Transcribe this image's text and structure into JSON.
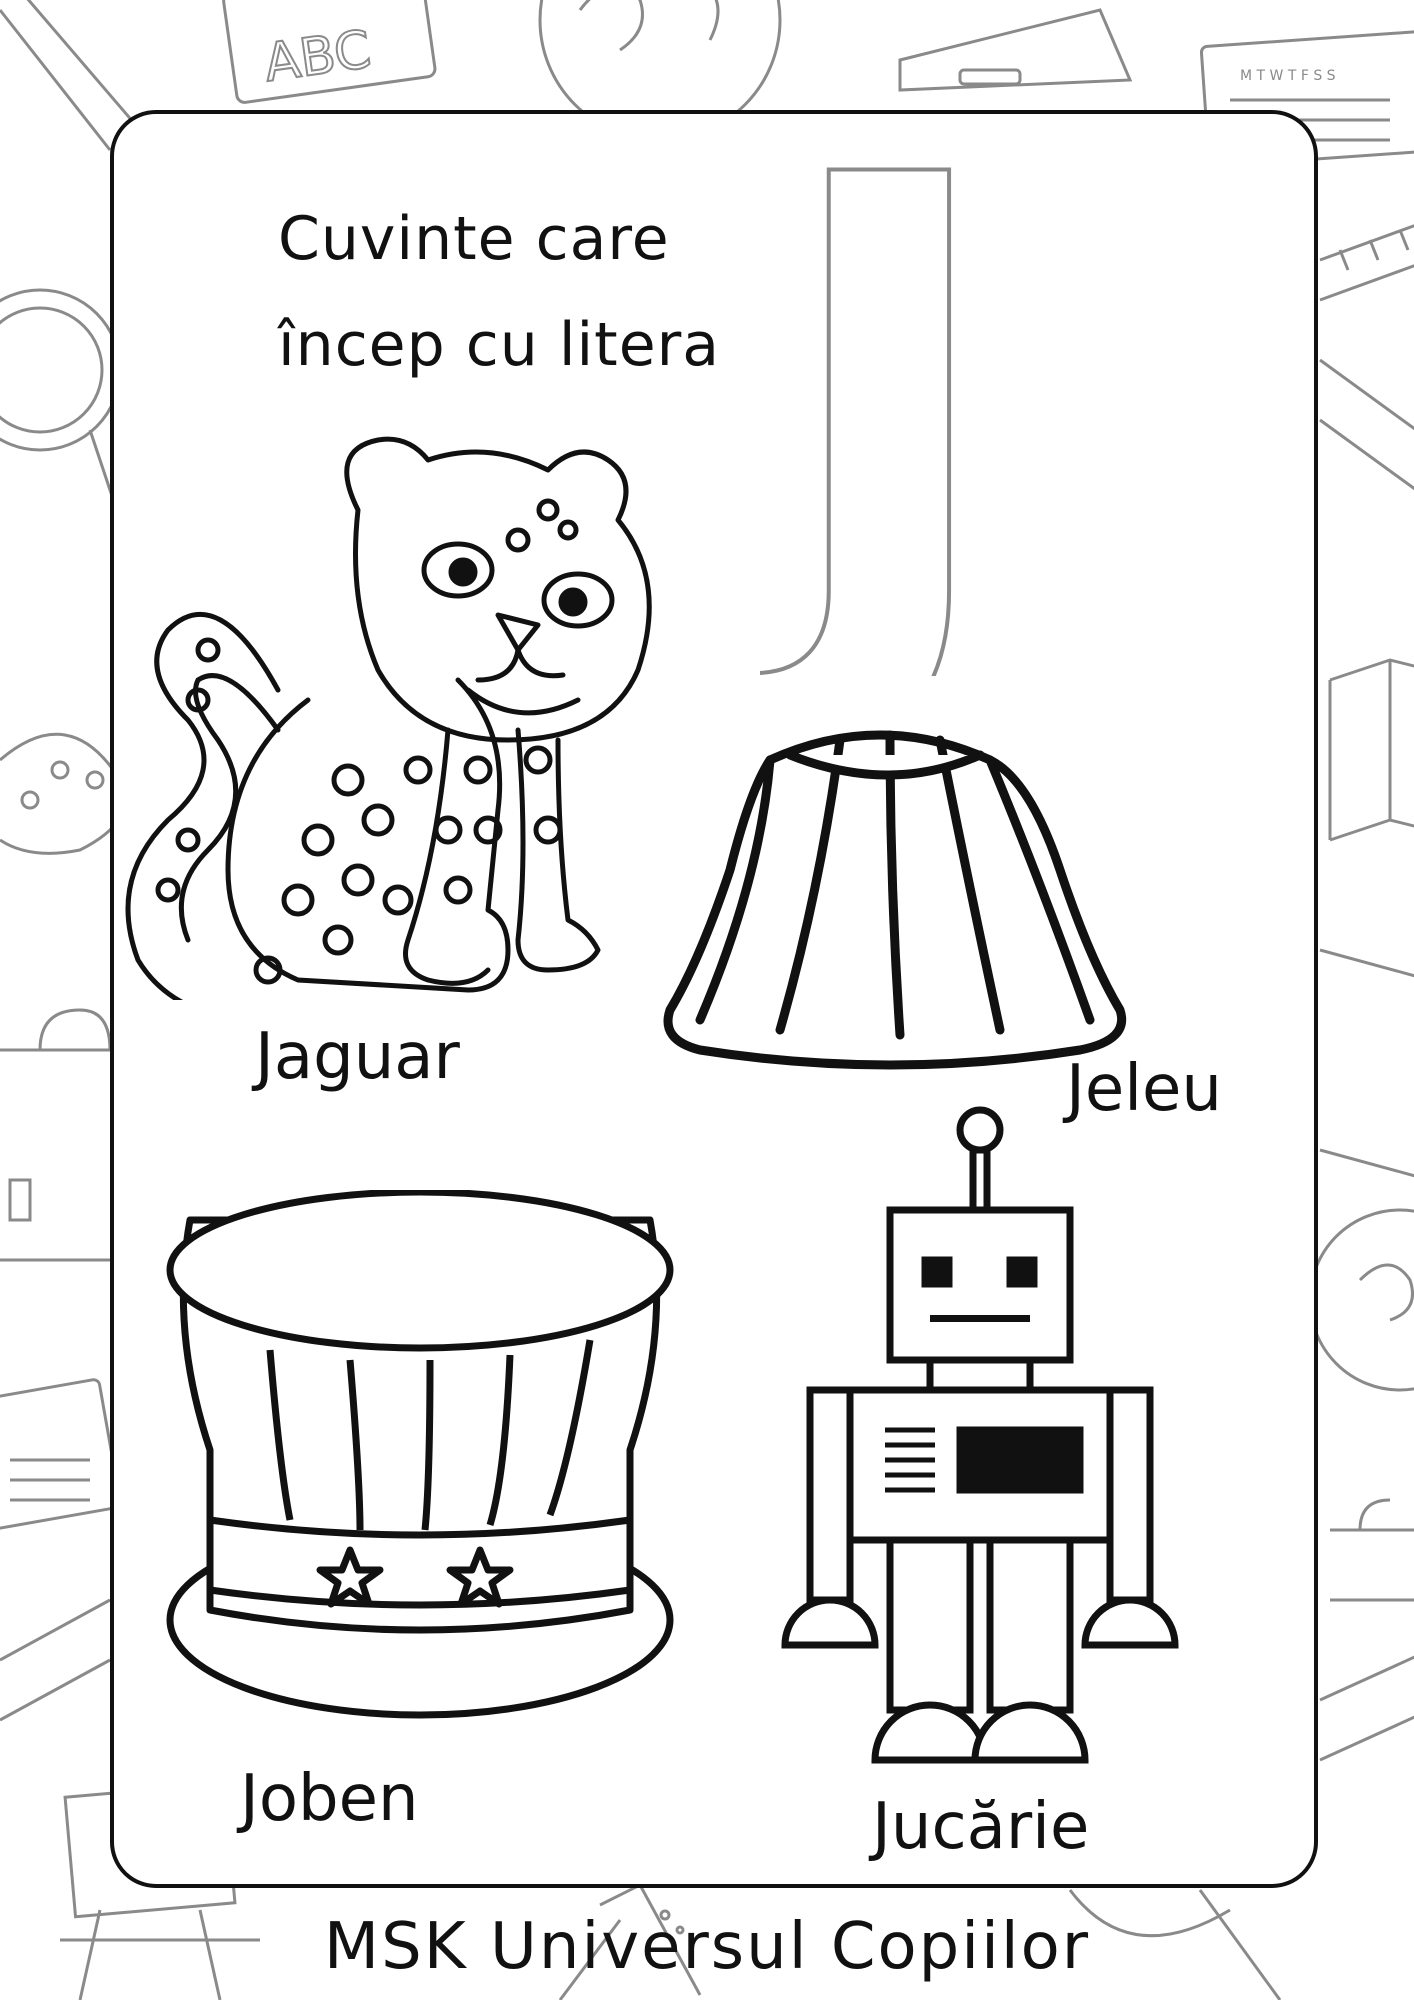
{
  "heading": {
    "line1": "Cuvinte care",
    "line2": "încep cu litera"
  },
  "letter": "J",
  "background_doodles": {
    "slate_text": "ABC",
    "calendar_days": "M T W T F S S"
  },
  "items": [
    {
      "word": "Jaguar",
      "icon": "jaguar-icon"
    },
    {
      "word": "Jeleu",
      "icon": "jelly-icon"
    },
    {
      "word": "Joben",
      "icon": "top-hat-icon"
    },
    {
      "word": "Jucărie",
      "icon": "robot-icon"
    }
  ],
  "footer": "MSK Universul Copiilor",
  "colors": {
    "ink": "#111111",
    "background": "#ffffff",
    "doodle": "#9a9a9a"
  }
}
